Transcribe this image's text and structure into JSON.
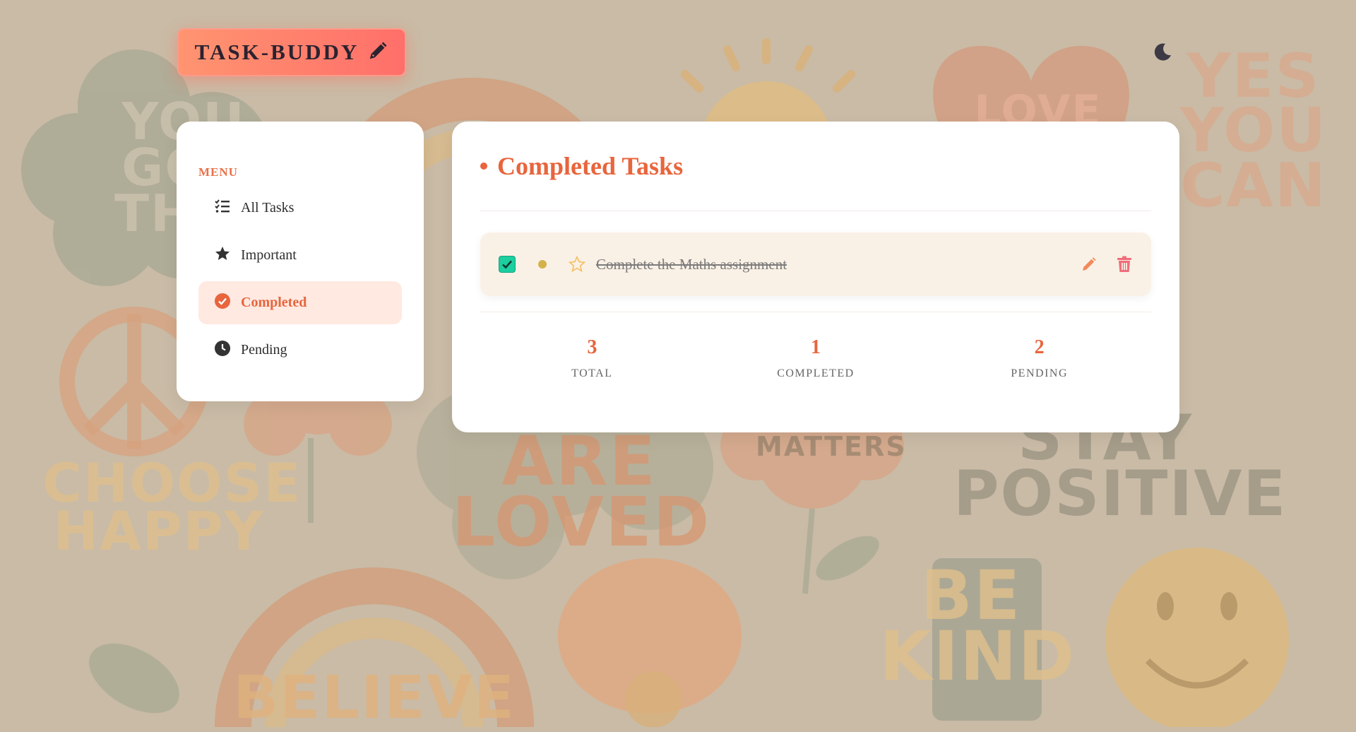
{
  "app": {
    "title": "TASK-BUDDY"
  },
  "header": {
    "theme_toggle_icon": "moon-icon"
  },
  "background": {
    "words": [
      "YOU GOT THIS",
      "LOVE",
      "YES YOU CAN",
      "CHOOSE HAPPY",
      "ARE LOVED",
      "MATTERS",
      "STAY POSITIVE",
      "BE KIND",
      "BELIEVE"
    ]
  },
  "sidebar": {
    "heading": "MENU",
    "items": [
      {
        "label": "All Tasks",
        "icon": "list-check-icon"
      },
      {
        "label": "Important",
        "icon": "star-icon"
      },
      {
        "label": "Completed",
        "icon": "check-circle-icon",
        "active": true
      },
      {
        "label": "Pending",
        "icon": "clock-icon"
      }
    ]
  },
  "main": {
    "title": "Completed Tasks",
    "tasks": [
      {
        "text": "Complete the Maths assignment",
        "completed": true,
        "important": false,
        "priority_color": "#d4b24a"
      }
    ],
    "stats": [
      {
        "value": "3",
        "label": "TOTAL"
      },
      {
        "value": "1",
        "label": "COMPLETED"
      },
      {
        "value": "2",
        "label": "PENDING"
      }
    ]
  },
  "colors": {
    "accent": "#e8653d",
    "brand_gradient_start": "#ff9470",
    "brand_gradient_end": "#ff6f6a",
    "check": "#1ccea0",
    "delete": "#f06d7a"
  }
}
